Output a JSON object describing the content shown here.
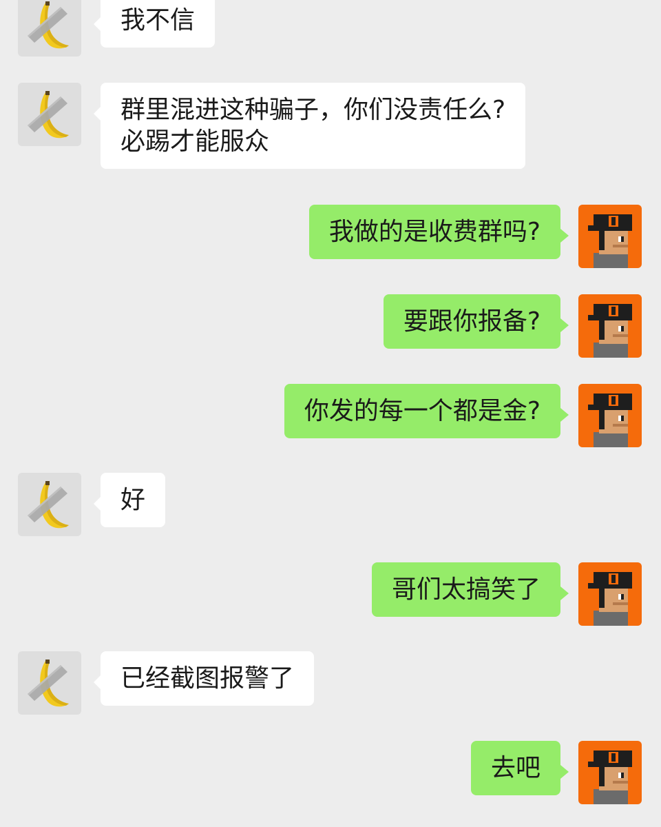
{
  "chat": {
    "contact_avatar_icon": "banana-duct-tape-icon",
    "self_avatar_icon": "pixel-character-icon",
    "colors": {
      "background": "#ededed",
      "incoming_bubble": "#ffffff",
      "outgoing_bubble": "#95ec69",
      "self_avatar_bg": "#f56b0b"
    },
    "messages": [
      {
        "side": "left",
        "lines": [
          "我不信"
        ]
      },
      {
        "side": "left",
        "lines": [
          "群里混进这种骗子，你们没责任么?",
          "必踢才能服众"
        ]
      },
      {
        "side": "right",
        "lines": [
          "我做的是收费群吗?"
        ]
      },
      {
        "side": "right",
        "lines": [
          "要跟你报备?"
        ]
      },
      {
        "side": "right",
        "lines": [
          "你发的每一个都是金?"
        ]
      },
      {
        "side": "left",
        "lines": [
          "好"
        ]
      },
      {
        "side": "right",
        "lines": [
          "哥们太搞笑了"
        ]
      },
      {
        "side": "left",
        "lines": [
          "已经截图报警了"
        ]
      },
      {
        "side": "right",
        "lines": [
          "去吧"
        ]
      }
    ]
  }
}
